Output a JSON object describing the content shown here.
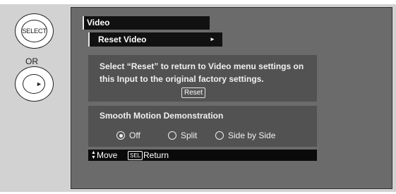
{
  "remote": {
    "select_label": "SELECT",
    "or_label": "OR"
  },
  "menu": {
    "title": "Video",
    "submenu": "Reset Video",
    "reset_description": "Select “Reset” to return to Video menu settings on this Input to the original factory settings.",
    "reset_button": "Reset",
    "smooth_title": "Smooth Motion Demonstration",
    "options": [
      {
        "label": "Off",
        "selected": true
      },
      {
        "label": "Split",
        "selected": false
      },
      {
        "label": "Side by Side",
        "selected": false
      }
    ]
  },
  "status": {
    "move_label": "Move",
    "sel_label": "SEL",
    "return_label": "Return"
  },
  "icons": {
    "updown": "updown-arrows-icon",
    "nav": "right-arrow-icon"
  }
}
